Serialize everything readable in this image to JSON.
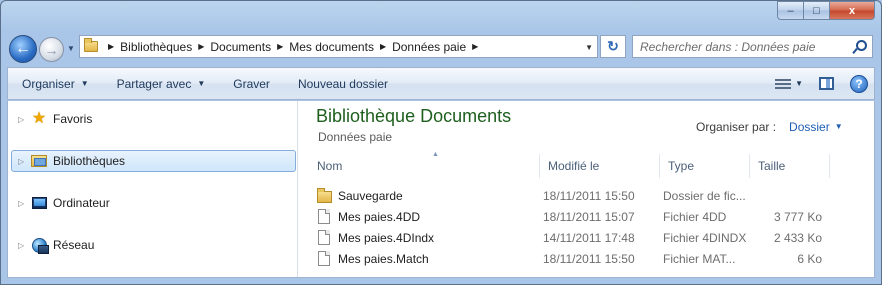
{
  "window": {
    "buttons": {
      "minimize": "–",
      "maximize": "□",
      "close": "x"
    }
  },
  "nav": {
    "back_glyph": "←",
    "forward_glyph": "→",
    "breadcrumbs": [
      "Bibliothèques",
      "Documents",
      "Mes documents",
      "Données paie"
    ],
    "refresh_glyph": "↻",
    "search_placeholder": "Rechercher dans : Données paie"
  },
  "toolbar": {
    "organize": "Organiser",
    "share": "Partager avec",
    "burn": "Graver",
    "new_folder": "Nouveau dossier",
    "help": "?"
  },
  "sidebar": {
    "items": [
      {
        "label": "Favoris",
        "icon": "star-icon"
      },
      {
        "label": "Bibliothèques",
        "icon": "libraries-icon",
        "selected": true
      },
      {
        "label": "Ordinateur",
        "icon": "computer-icon"
      },
      {
        "label": "Réseau",
        "icon": "network-icon"
      }
    ]
  },
  "library": {
    "title": "Bibliothèque Documents",
    "subtitle": "Données paie",
    "arrange_label": "Organiser par :",
    "arrange_value": "Dossier"
  },
  "columns": {
    "name": "Nom",
    "modified": "Modifié le",
    "type": "Type",
    "size": "Taille"
  },
  "files": [
    {
      "name": "Sauvegarde",
      "modified": "18/11/2011 15:50",
      "type": "Dossier de fic...",
      "size": "",
      "icon": "folder-icon"
    },
    {
      "name": "Mes paies.4DD",
      "modified": "18/11/2011 15:07",
      "type": "Fichier 4DD",
      "size": "3 777 Ko",
      "icon": "file-icon"
    },
    {
      "name": "Mes paies.4DIndx",
      "modified": "14/11/2011 17:48",
      "type": "Fichier 4DINDX",
      "size": "2 433 Ko",
      "icon": "file-icon"
    },
    {
      "name": "Mes paies.Match",
      "modified": "18/11/2011 15:50",
      "type": "Fichier MAT...",
      "size": "6 Ko",
      "icon": "file-icon"
    }
  ]
}
